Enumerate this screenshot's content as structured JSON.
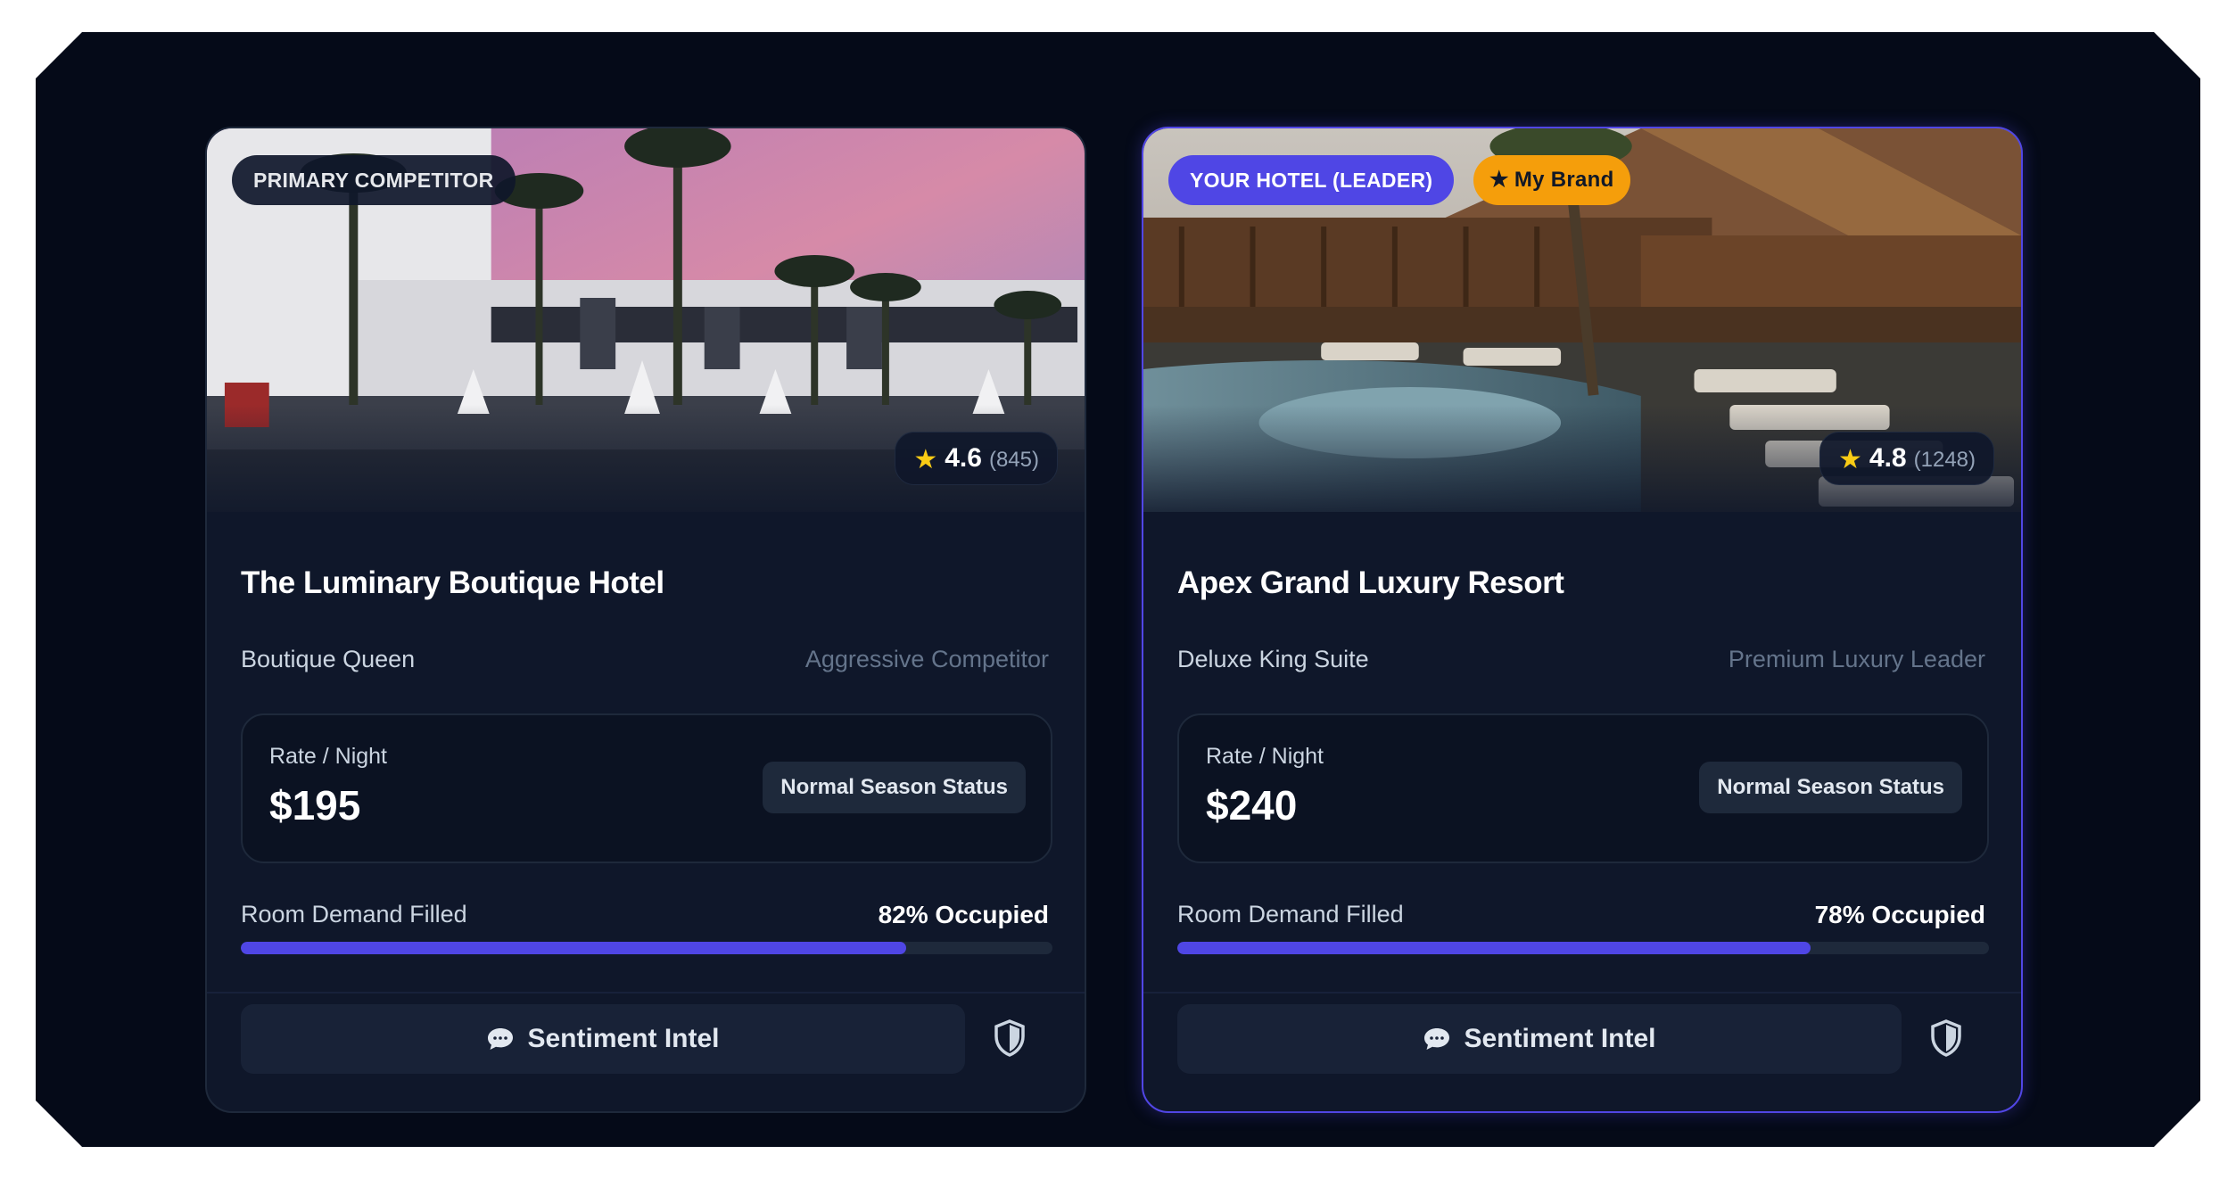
{
  "cards": [
    {
      "badge": "PRIMARY COMPETITOR",
      "rating": {
        "score": "4.6",
        "count": "(845)"
      },
      "title": "The Luminary Boutique Hotel",
      "room_type": "Boutique Queen",
      "positioning": "Aggressive Competitor",
      "rate_label": "Rate / Night",
      "rate_value": "$195",
      "season_status": "Normal Season Status",
      "demand_label": "Room Demand Filled",
      "demand_value": "82% Occupied",
      "occupancy_fraction": 0.82,
      "sentiment_label": "Sentiment Intel",
      "icons": {
        "rating": "star-icon",
        "chat": "chat-icon",
        "shield": "shield-icon"
      }
    },
    {
      "badge": "YOUR HOTEL (LEADER)",
      "brand_badge": "My Brand",
      "rating": {
        "score": "4.8",
        "count": "(1248)"
      },
      "title": "Apex Grand Luxury Resort",
      "room_type": "Deluxe King Suite",
      "positioning": "Premium Luxury Leader",
      "rate_label": "Rate / Night",
      "rate_value": "$240",
      "season_status": "Normal Season Status",
      "demand_label": "Room Demand Filled",
      "demand_value": "78% Occupied",
      "occupancy_fraction": 0.78,
      "sentiment_label": "Sentiment Intel",
      "icons": {
        "rating": "star-icon",
        "chat": "chat-icon",
        "shield": "shield-icon",
        "brand": "star-icon"
      }
    }
  ],
  "colors": {
    "background": "#050a18",
    "card": "#0f172a",
    "accent": "#4f46e5",
    "brand_badge": "#f59e0b",
    "rating_star": "#facc15"
  }
}
